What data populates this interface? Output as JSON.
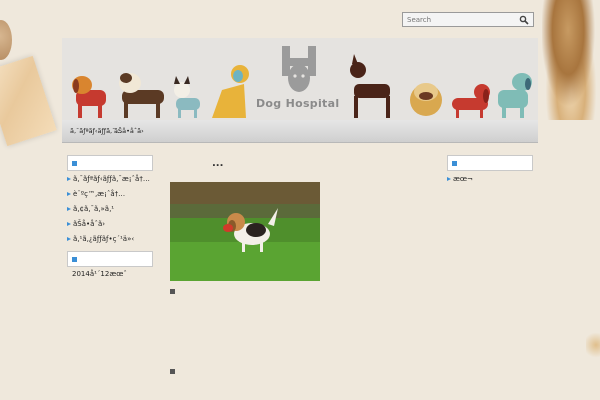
{
  "search": {
    "placeholder": "Search"
  },
  "header": {
    "logo_text": "Dog Hospital"
  },
  "nav": {
    "items": [
      "ã‚¯ãƒªãƒ‹ãƒƒã‚¯...",
      "ãŠå•åˆã›"
    ]
  },
  "sidebar_left": {
    "widget1_items": [
      "ã‚¯ãƒªãƒ‹ãƒƒã‚¯æ¡ˆå†…",
      "è¨ºç™‚æ¡ˆå†…",
      "ã‚¢ã‚¯ã‚»ã‚¹",
      "ãŠå•åˆã›",
      "ã‚¹ã‚¿ãƒƒãƒ•ç´¹ä»‹"
    ],
    "widget2_items": [
      "2014å¹´12æœˆ"
    ]
  },
  "sidebar_right": {
    "widget1_items": [
      "æœ¬"
    ]
  },
  "main": {
    "dots": "..."
  },
  "colors": {
    "background": "#efe8dc",
    "accent": "#3b8fd6",
    "header_bg": "#e5e3e0"
  }
}
